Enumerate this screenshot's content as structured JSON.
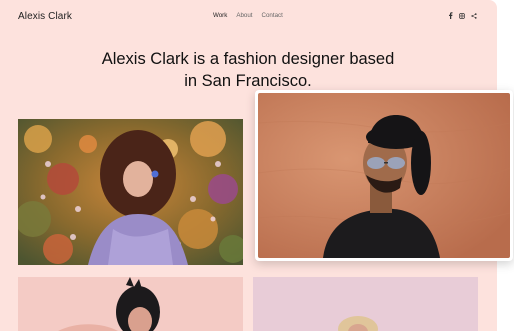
{
  "site": {
    "brand": "Alexis Clark",
    "nav": [
      {
        "label": "Work",
        "active": true
      },
      {
        "label": "About",
        "active": false
      },
      {
        "label": "Contact",
        "active": false
      }
    ],
    "social_icons": [
      "facebook-icon",
      "instagram-icon",
      "share-icon"
    ],
    "headline_line1": "Alexis Clark is a fashion designer based",
    "headline_line2": "in San Francisco."
  },
  "gallery": {
    "photos": [
      {
        "name": "woman-curly-hair-flowers-photo"
      },
      {
        "name": "man-hat-sunglasses-photo"
      },
      {
        "name": "woman-dark-hair-photo"
      },
      {
        "name": "woman-blonde-hair-photo"
      }
    ]
  },
  "colors": {
    "background": "#fde2dd",
    "text": "#111111"
  }
}
